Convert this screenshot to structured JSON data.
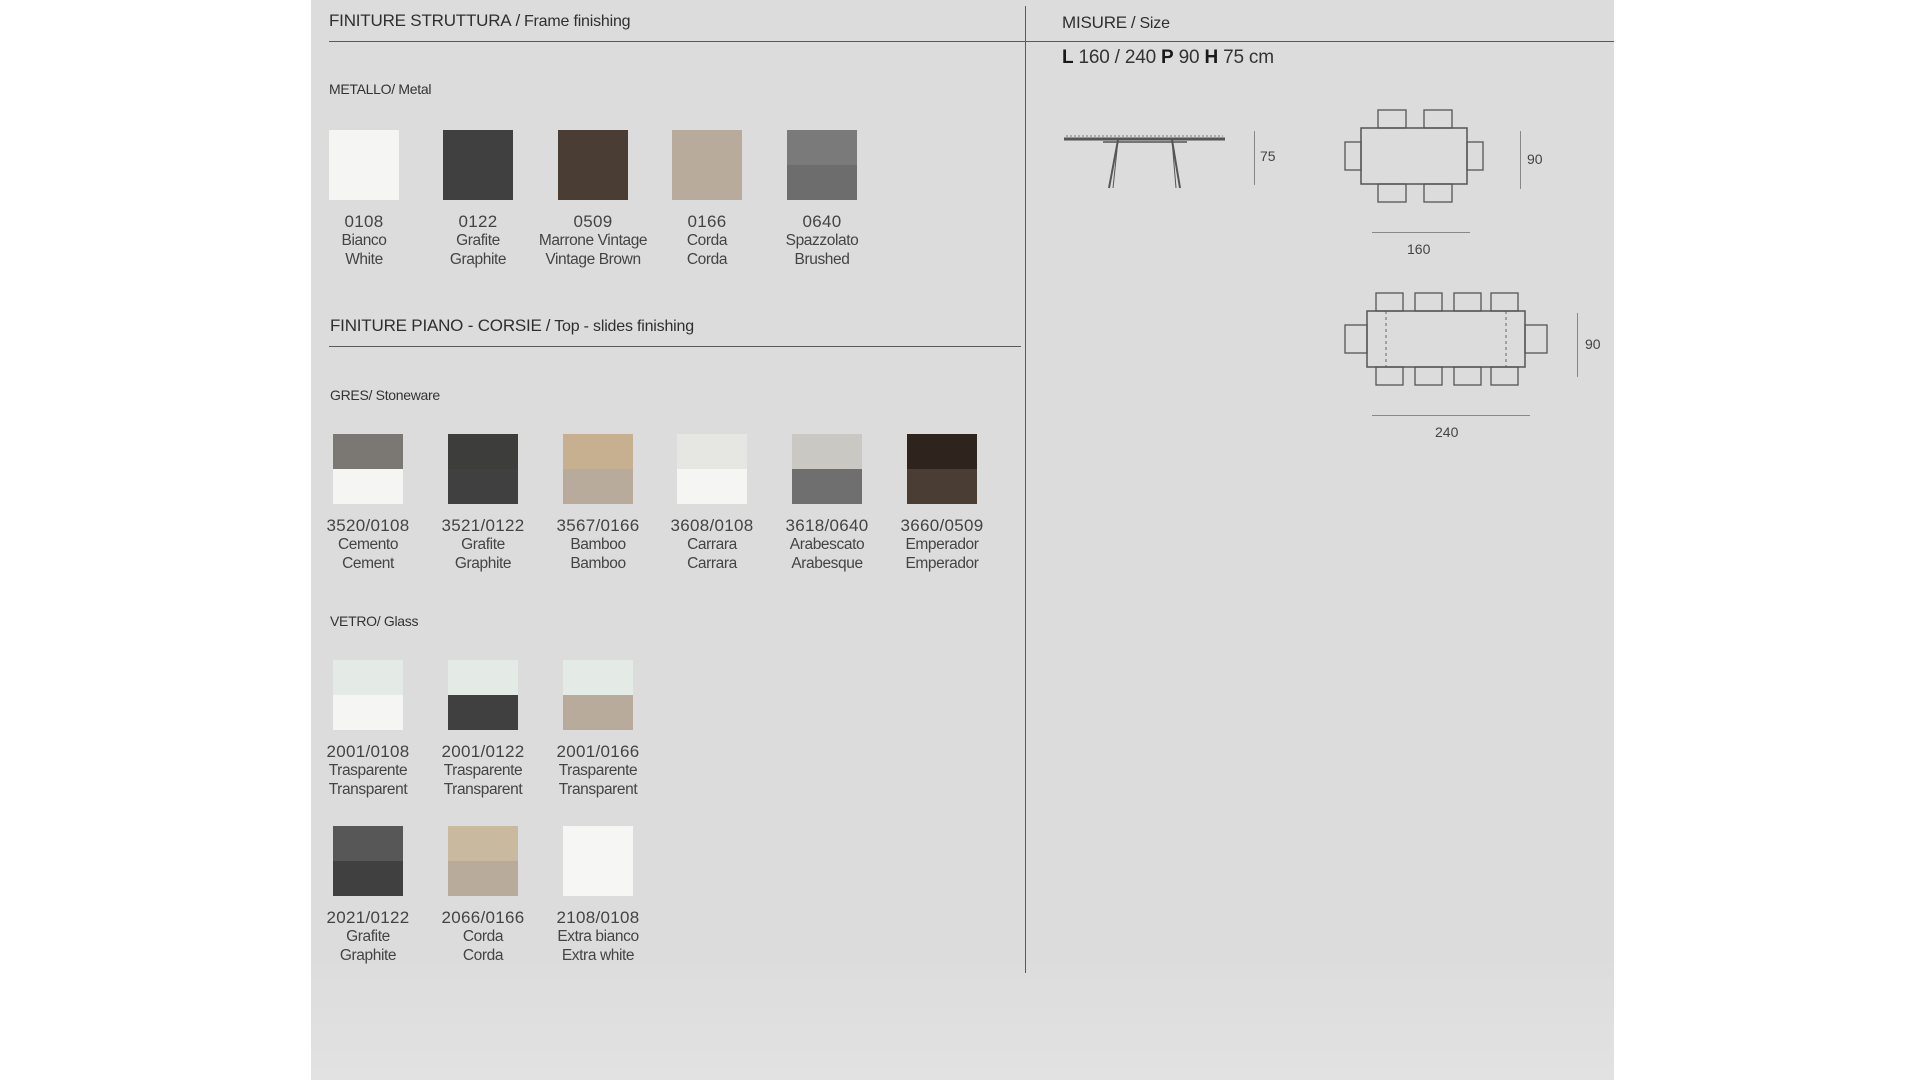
{
  "frame": {
    "title_it": "FINITURE STRUTTURA",
    "title_en": "Frame finishing",
    "metal_label": "METALLO/ Metal",
    "metal": [
      {
        "code": "0108",
        "it": "Bianco",
        "en": "White",
        "c1": "#f5f5f4",
        "c2": "#f5f5f4"
      },
      {
        "code": "0122",
        "it": "Grafite",
        "en": "Graphite",
        "c1": "#404040",
        "c2": "#404040"
      },
      {
        "code": "0509",
        "it": "Marrone Vintage",
        "en": "Vintage Brown",
        "c1": "#4a3d33",
        "c2": "#4a3d33"
      },
      {
        "code": "0166",
        "it": "Corda",
        "en": "Corda",
        "c1": "#b9ab9b",
        "c2": "#b9ab9b"
      },
      {
        "code": "0640",
        "it": "Spazzolato",
        "en": "Brushed",
        "c1": "#7a7a7a",
        "c2": "#6d6d6d"
      }
    ]
  },
  "top": {
    "title_it": "FINITURE PIANO - CORSIE",
    "title_en": "Top - slides finishing",
    "gres_label": "GRES/ Stoneware",
    "gres": [
      {
        "code": "3520/0108",
        "it": "Cemento",
        "en": "Cement",
        "c1": "#7b7874",
        "c2": "#f5f5f4"
      },
      {
        "code": "3521/0122",
        "it": "Grafite",
        "en": "Graphite",
        "c1": "#3d3e3b",
        "c2": "#404040"
      },
      {
        "code": "3567/0166",
        "it": "Bamboo",
        "en": "Bamboo",
        "c1": "#c7b08f",
        "c2": "#b9ab9b"
      },
      {
        "code": "3608/0108",
        "it": "Carrara",
        "en": "Carrara",
        "c1": "#e6e6e2",
        "c2": "#f5f5f4"
      },
      {
        "code": "3618/0640",
        "it": "Arabescato",
        "en": "Arabesque",
        "c1": "#c9c8c3",
        "c2": "#6f6f6f"
      },
      {
        "code": "3660/0509",
        "it": "Emperador",
        "en": "Emperador",
        "c1": "#2e241d",
        "c2": "#4a3d33"
      }
    ],
    "glass_label": "VETRO/ Glass",
    "glass": [
      {
        "code": "2001/0108",
        "it": "Trasparente",
        "en": "Transparent",
        "c1": "#e4ebe7",
        "c2": "#f5f5f4"
      },
      {
        "code": "2001/0122",
        "it": "Trasparente",
        "en": "Transparent",
        "c1": "#e4ebe7",
        "c2": "#404040"
      },
      {
        "code": "2001/0166",
        "it": "Trasparente",
        "en": "Transparent",
        "c1": "#e4ebe7",
        "c2": "#b9ab9b"
      },
      {
        "code": "2021/0122",
        "it": "Grafite",
        "en": "Graphite",
        "c1": "#575757",
        "c2": "#404040"
      },
      {
        "code": "2066/0166",
        "it": "Corda",
        "en": "Corda",
        "c1": "#c8b99f",
        "c2": "#b9ab9b"
      },
      {
        "code": "2108/0108",
        "it": "Extra bianco",
        "en": "Extra white",
        "c1": "#f6f6f5",
        "c2": "#f6f6f5"
      }
    ]
  },
  "size": {
    "title_it": "MISURE",
    "title_en": "Size",
    "l_label": "L",
    "l_value": "160 / 240",
    "p_label": "P",
    "p_value": "90",
    "h_label": "H",
    "h_value": "75 cm",
    "side_height": "75",
    "plan_small_length": "160",
    "plan_small_depth": "90",
    "plan_large_length": "240",
    "plan_large_depth": "90"
  }
}
